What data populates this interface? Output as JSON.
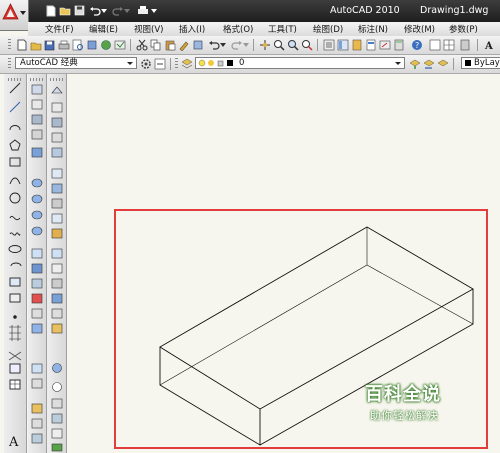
{
  "window": {
    "app_title": "AutoCAD 2010",
    "doc_title": "Drawing1.dwg"
  },
  "menu": {
    "items": [
      "文件(F)",
      "编辑(E)",
      "视图(V)",
      "插入(I)",
      "格式(O)",
      "工具(T)",
      "绘图(D)",
      "标注(N)",
      "修改(M)",
      "参数(P)"
    ]
  },
  "toolbar": {
    "workspace_value": "AutoCAD 经典",
    "layer_value": "0",
    "color_value": "ByLayer"
  },
  "watermark": {
    "title": "百科全说",
    "subtitle": "助你轻松解决"
  },
  "colors": {
    "highlight_box": "#e23c3c",
    "canvas_bg": "#f7f6ee",
    "title_bar": "#2b2b2b"
  },
  "icons": {
    "app": "autocad-logo-icon",
    "quick_access": [
      "new-icon",
      "open-icon",
      "save-icon",
      "undo-icon",
      "redo-icon",
      "plot-icon"
    ]
  }
}
